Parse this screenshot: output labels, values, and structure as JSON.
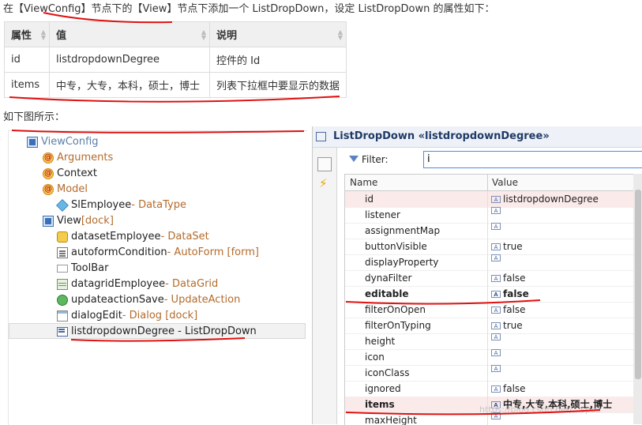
{
  "intro": "在【ViewConfig】节点下的【View】节点下添加一个 ListDropDown，设定 ListDropDown 的属性如下：",
  "property_table": {
    "headers": [
      "属性",
      "值",
      "说明"
    ],
    "rows": [
      [
        "id",
        "listdropdownDegree",
        "控件的 Id"
      ],
      [
        "items",
        "中专，大专，本科，硕士，博士",
        "列表下拉框中要显示的数据"
      ]
    ]
  },
  "caption": "如下图所示：",
  "tree": [
    {
      "name": "ViewConfig",
      "meta": "",
      "icon": "viewconfig-icon"
    },
    {
      "name": "Arguments",
      "meta": "",
      "icon": "arguments-icon"
    },
    {
      "name": "Context",
      "meta": "",
      "icon": "context-icon"
    },
    {
      "name": "Model",
      "meta": "",
      "icon": "model-icon"
    },
    {
      "name": "SlEmployee",
      "meta": " - DataType",
      "icon": "datatype-icon"
    },
    {
      "name": "View",
      "meta": " [dock]",
      "icon": "view-icon"
    },
    {
      "name": "datasetEmployee",
      "meta": " - DataSet",
      "icon": "dataset-icon"
    },
    {
      "name": "autoformCondition",
      "meta": " - AutoForm [form]",
      "icon": "autoform-icon"
    },
    {
      "name": "ToolBar",
      "meta": "",
      "icon": "toolbar-icon"
    },
    {
      "name": "datagridEmployee",
      "meta": " - DataGrid",
      "icon": "datagrid-icon"
    },
    {
      "name": "updateactionSave",
      "meta": " - UpdateAction",
      "icon": "updateaction-icon"
    },
    {
      "name": "dialogEdit",
      "meta": " - Dialog [dock]",
      "icon": "dialog-icon"
    },
    {
      "name": "listdropdownDegree - ListDropDown",
      "meta": "",
      "icon": "listdropdown-icon"
    }
  ],
  "properties_view": {
    "title": "ListDropDown «listdropdownDegree»",
    "filter_label": "Filter:",
    "filter_value": "i",
    "col_name": "Name",
    "col_value": "Value",
    "rows": [
      {
        "name": "id",
        "value": "listdropdownDegree"
      },
      {
        "name": "listener",
        "value": ""
      },
      {
        "name": "assignmentMap",
        "value": ""
      },
      {
        "name": "buttonVisible",
        "value": "true"
      },
      {
        "name": "displayProperty",
        "value": ""
      },
      {
        "name": "dynaFilter",
        "value": "false"
      },
      {
        "name": "editable",
        "value": "false"
      },
      {
        "name": "filterOnOpen",
        "value": "false"
      },
      {
        "name": "filterOnTyping",
        "value": "true"
      },
      {
        "name": "height",
        "value": ""
      },
      {
        "name": "icon",
        "value": ""
      },
      {
        "name": "iconClass",
        "value": ""
      },
      {
        "name": "ignored",
        "value": "false"
      },
      {
        "name": "items",
        "value": "中专,大专,本科,硕士,博士"
      },
      {
        "name": "maxHeight",
        "value": ""
      }
    ]
  },
  "watermark": "https://blog.csdn.net/...spos"
}
